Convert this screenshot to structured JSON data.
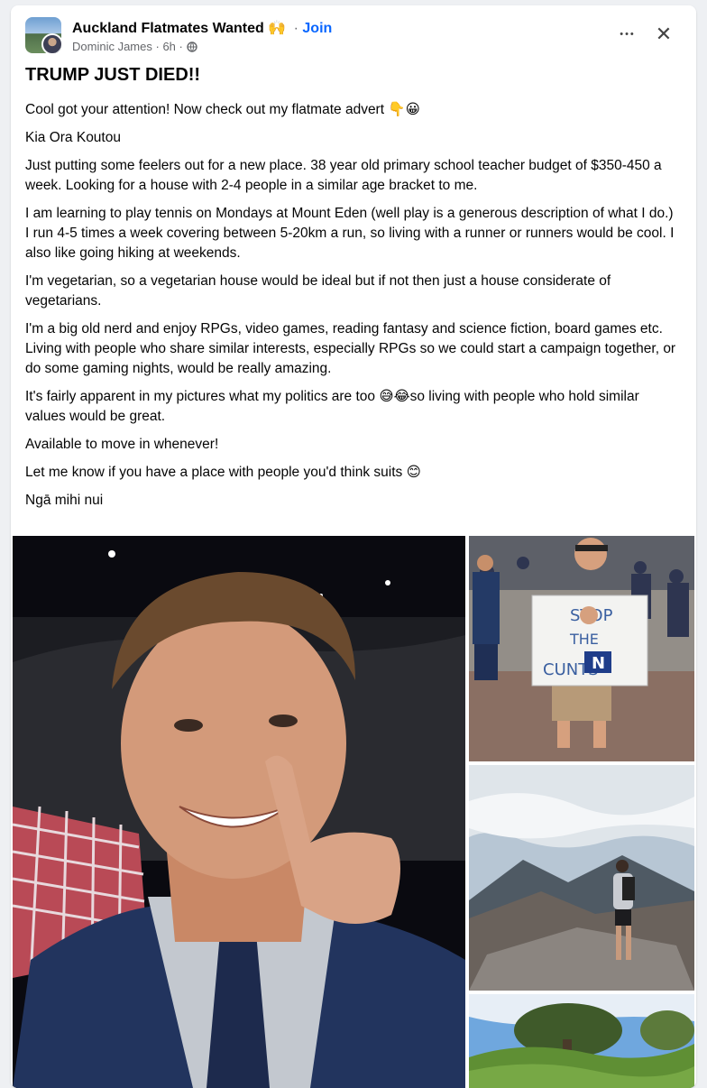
{
  "group": {
    "name": "Auckland Flatmates Wanted",
    "emoji": "🙌",
    "separator": "·",
    "join_label": "Join"
  },
  "author": {
    "name": "Dominic James",
    "separator": "·",
    "time": "6h",
    "audience_icon": "globe-icon"
  },
  "actions": {
    "more_icon": "more-horizontal-icon",
    "more_label": "•••",
    "close_icon": "close-icon",
    "close_label": "✕"
  },
  "post": {
    "title": "TRUMP JUST DIED!!",
    "paragraphs": [
      "Cool got your attention! Now check out my flatmate advert 👇😀",
      "Kia Ora Koutou",
      "Just putting some feelers out for a new place. 38 year old primary school teacher budget of $350-450 a week. Looking for a house with 2-4 people in a similar age bracket to me.",
      "I am learning to play tennis on Mondays at Mount Eden (well play is a generous description of what I do.) I run 4-5 times a week covering between 5-20km a run, so living with a runner or runners would be cool. I also like going hiking at weekends.",
      "I'm vegetarian, so a vegetarian house would be ideal but if not then just a house considerate of vegetarians.",
      "I'm a big old nerd and enjoy RPGs, video games, reading fantasy and science fiction, board games etc. Living with people who share similar interests, especially RPGs so we could start a campaign together, or do some gaming nights, would be really amazing.",
      "It's fairly apparent in my pictures what my politics are too 😅😂so living with people who hold similar values would be great.",
      "Available to move in whenever!",
      "Let me know if you have a place with people you'd think suits 😊",
      "Ngā mihi nui"
    ]
  },
  "photos": {
    "protest_sign": {
      "line1": "STOP",
      "line2": "THE",
      "line3": "CUNTS",
      "logo": "N"
    }
  }
}
